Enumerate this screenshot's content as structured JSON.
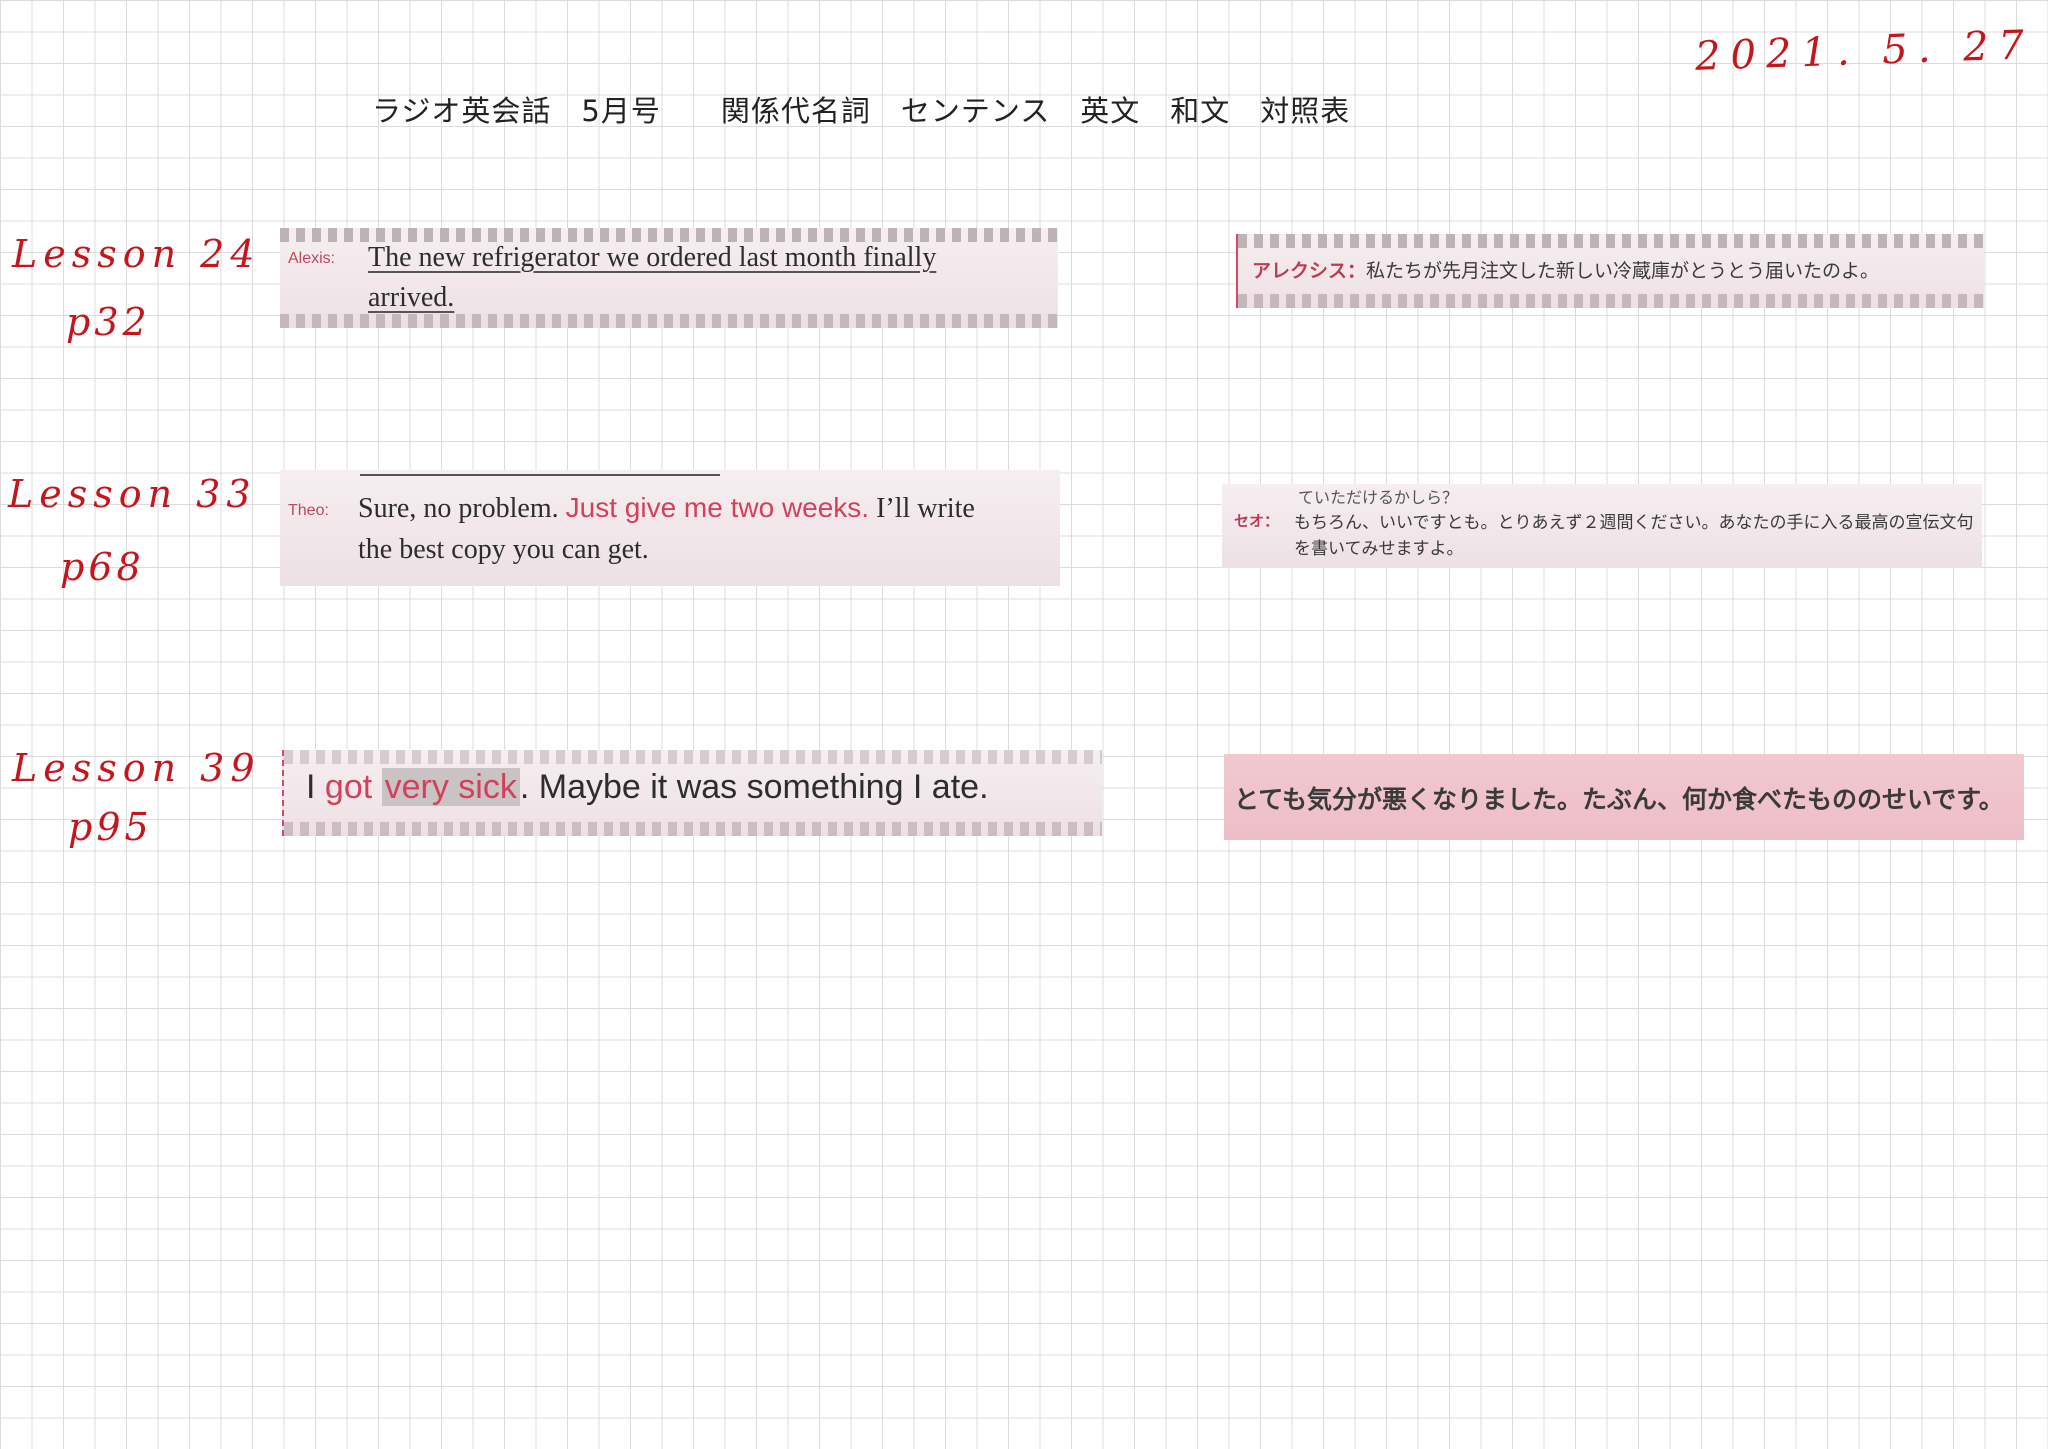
{
  "header": {
    "date": "2021. 5. 27",
    "title": "ラジオ英会話　5月号　　関係代名詞　センテンス　英文　和文　対照表"
  },
  "rows": [
    {
      "lesson": "Lesson 24",
      "page": "p32",
      "en": {
        "speaker": "Alexis:",
        "line1": "The new refrigerator we ordered last month finally",
        "line2": "arrived."
      },
      "jp": {
        "speaker": "アレクシス：",
        "text": "私たちが先月注文した新しい冷蔵庫がとうとう届いたのよ。"
      }
    },
    {
      "lesson": "Lesson 33",
      "page": "p68",
      "en": {
        "speaker": "Theo:",
        "line1_a": "Sure, no problem. ",
        "line1_b": "Just give me two weeks.",
        "line1_c": " I’ll write",
        "line2": "the best copy you can get."
      },
      "jp": {
        "top": "ていただけるかしら？",
        "speaker": "セオ：",
        "line1": "もちろん、いいですとも。とりあえず２週間ください。あなたの手に入る最高の宣伝文句",
        "line2": "を書いてみせますよ。"
      }
    },
    {
      "lesson": "Lesson 39",
      "page": "p95",
      "en": {
        "a": "I ",
        "b": "got",
        "c": "very sick",
        "d": ". Maybe it was something I ate."
      },
      "jp": {
        "text": "とても気分が悪くなりました。たぶん、何か食べたもののせいです。"
      }
    }
  ]
}
